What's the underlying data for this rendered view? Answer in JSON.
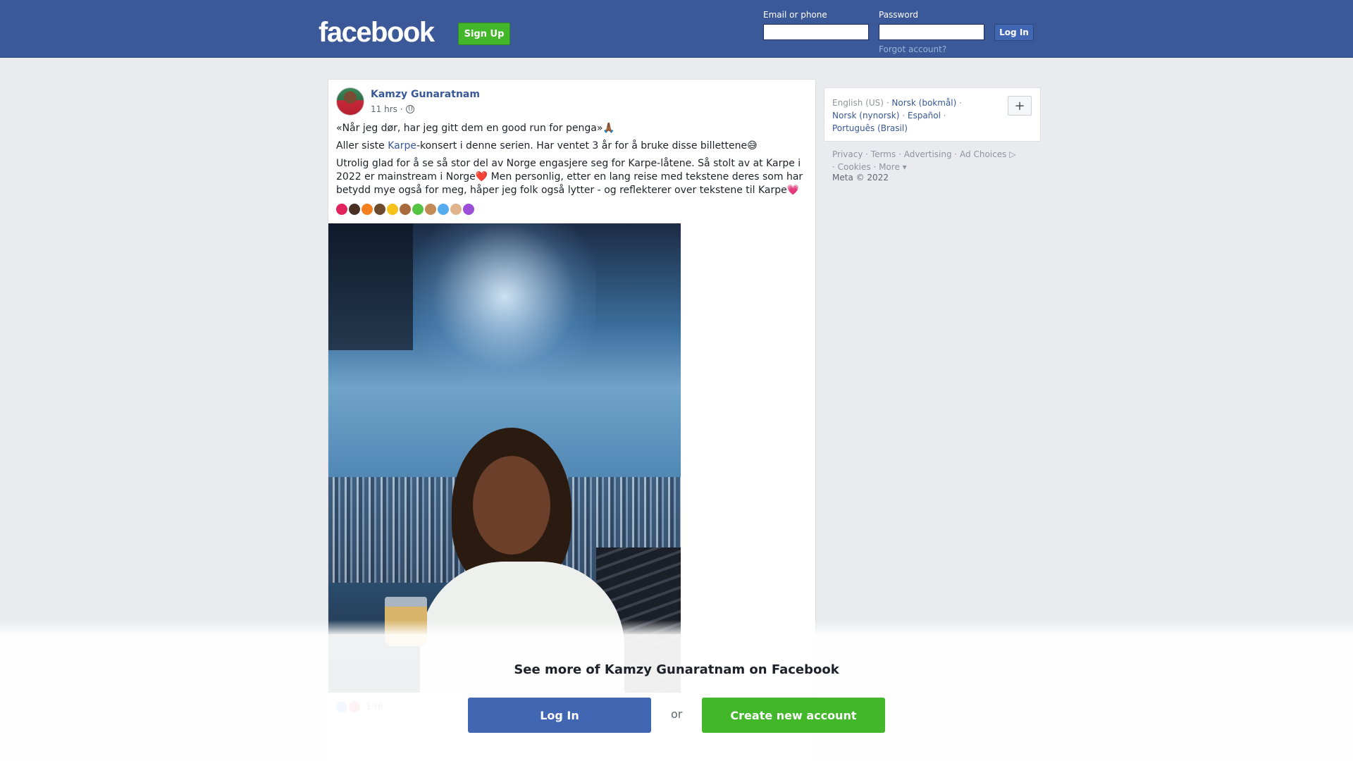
{
  "header": {
    "logo": "facebook",
    "signup_label": "Sign Up",
    "email_label": "Email or phone",
    "email_value": "",
    "password_label": "Password",
    "password_value": "",
    "login_label": "Log In",
    "forgot_label": "Forgot account?"
  },
  "post": {
    "author": "Kamzy Gunaratnam",
    "time": "11 hrs ·",
    "privacy_icon": "globe-icon",
    "paragraphs": {
      "p1": "«Når jeg dør, har jeg gitt dem en good run for penga»🙏🏾",
      "p2_before": "Aller siste ",
      "p2_link": "Karpe",
      "p2_after": "-konsert i denne serien. Har ventet 3 år for å bruke disse billettene😅",
      "p3": "Utrolig glad for å se så stor del av Norge engasjere seg for Karpe-låtene. Så stolt av at Karpe i 2022 er mainstream i Norge❤️ Men personlig, etter en lang reise med tekstene deres som har betydd mye også for meg, håper jeg folk også lytter - og reflekterer over tekstene til Karpe💗"
    },
    "emoji_row": [
      "#e0245e",
      "#4a3022",
      "#f4801f",
      "#6b4a2e",
      "#f7c21a",
      "#a86a3c",
      "#56c443",
      "#c48a55",
      "#55acee",
      "#e0b48c",
      "#9b4fd9"
    ],
    "reaction_count": "196"
  },
  "sidebar": {
    "languages": {
      "current": "English (US)",
      "items": [
        "Norsk (bokmål)",
        "Norsk (nynorsk)",
        "Español",
        "Português (Brasil)"
      ]
    },
    "plus_label": "+",
    "footer": {
      "links": [
        "Privacy",
        "Terms",
        "Advertising",
        "Ad Choices",
        "Cookies",
        "More"
      ],
      "copyright": "Meta © 2022"
    }
  },
  "overlay": {
    "title": "See more of Kamzy Gunaratnam on Facebook",
    "login_label": "Log In",
    "or_label": "or",
    "create_label": "Create new account"
  },
  "colors": {
    "brand_blue": "#3b5998",
    "button_blue": "#4267b2",
    "green": "#42b72a",
    "link": "#385898"
  }
}
